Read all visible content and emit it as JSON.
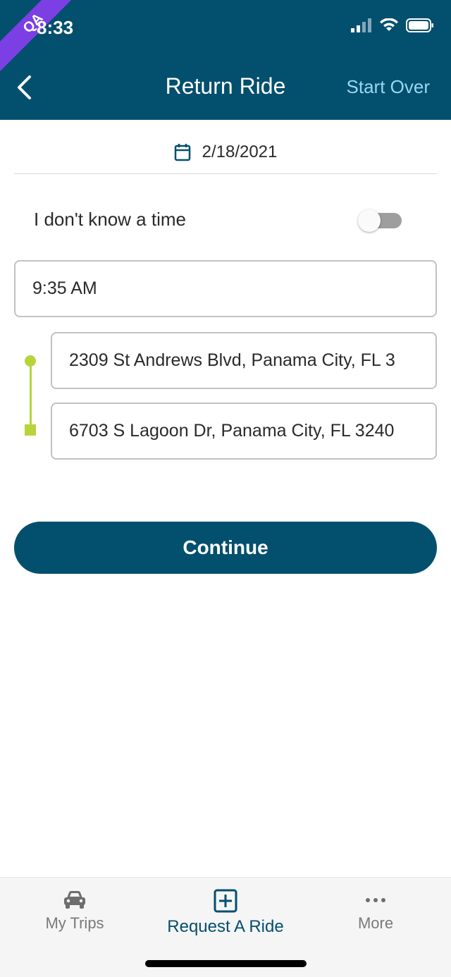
{
  "status_bar": {
    "time": "8:33",
    "badge": "QA"
  },
  "header": {
    "title": "Return Ride",
    "start_over_label": "Start Over",
    "back_icon": "chevron-left-icon"
  },
  "date": {
    "value": "2/18/2021",
    "icon": "calendar-icon"
  },
  "time_toggle": {
    "label": "I don't know a time",
    "enabled": false
  },
  "time_field": {
    "value": "9:35 AM"
  },
  "route": {
    "pickup": "2309 St Andrews Blvd, Panama City, FL 3",
    "dropoff": "6703 S Lagoon Dr, Panama City, FL 3240"
  },
  "continue_label": "Continue",
  "tabs": [
    {
      "label": "My Trips",
      "icon": "car-icon",
      "active": false
    },
    {
      "label": "Request A Ride",
      "icon": "plus-square-icon",
      "active": true
    },
    {
      "label": "More",
      "icon": "more-dots-icon",
      "active": false
    }
  ],
  "colors": {
    "primary": "#034f6e",
    "accent_link": "#9ad7f2",
    "route": "#b7d43a",
    "ribbon": "#7b3fe4"
  }
}
